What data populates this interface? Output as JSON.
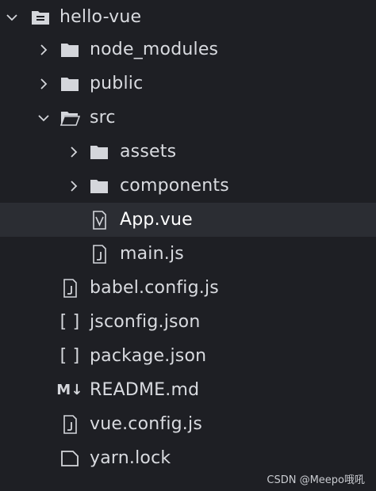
{
  "explorer": {
    "root": {
      "label": "hello-vue",
      "icon": "root-folder-icon",
      "expanded": true
    },
    "items": [
      {
        "label": "node_modules",
        "icon": "folder-icon",
        "expanded": false
      },
      {
        "label": "public",
        "icon": "folder-icon",
        "expanded": false
      },
      {
        "label": "src",
        "icon": "folder-open-icon",
        "expanded": true
      },
      {
        "label": "assets",
        "icon": "folder-icon",
        "expanded": false
      },
      {
        "label": "components",
        "icon": "folder-icon",
        "expanded": false
      },
      {
        "label": "App.vue",
        "icon": "vue-file-icon",
        "selected": true
      },
      {
        "label": "main.js",
        "icon": "js-file-icon"
      },
      {
        "label": "babel.config.js",
        "icon": "js-file-icon"
      },
      {
        "label": "jsconfig.json",
        "icon": "json-file-icon",
        "icon_text": "[ ]"
      },
      {
        "label": "package.json",
        "icon": "json-file-icon",
        "icon_text": "[ ]"
      },
      {
        "label": "README.md",
        "icon": "markdown-file-icon",
        "icon_text": "M↓"
      },
      {
        "label": "vue.config.js",
        "icon": "js-file-icon"
      },
      {
        "label": "yarn.lock",
        "icon": "file-icon"
      }
    ]
  },
  "watermark": "CSDN @Meepo哦吼",
  "colors": {
    "background": "#1e1f24",
    "selected": "#2b2d33",
    "icon": "#d4d6db",
    "text": "#d9dbe0"
  }
}
